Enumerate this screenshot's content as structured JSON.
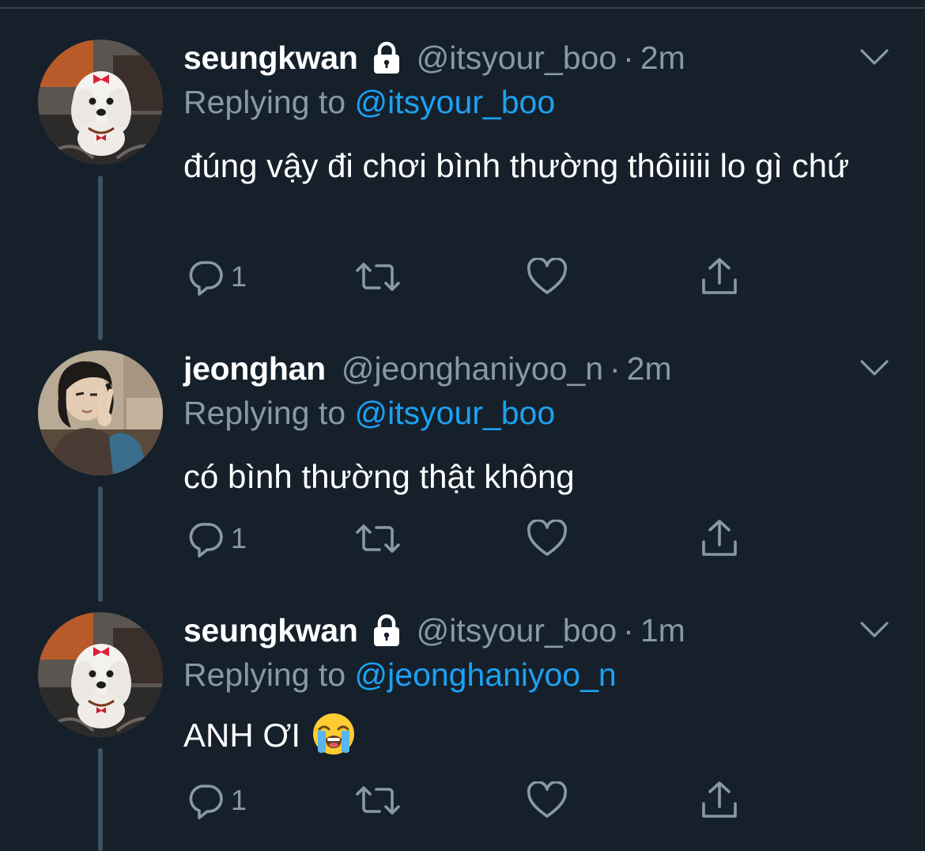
{
  "tweets": [
    {
      "name": "seungkwan",
      "protected": true,
      "handle": "@itsyour_boo",
      "dot": "·",
      "time": "2m",
      "replying_prefix": "Replying to",
      "replying_to": "@itsyour_boo",
      "text": "đúng vậy đi chơi bình thường thôiiiii lo gì chứ",
      "reply_count": "1",
      "avatar": "white-maltese-dog-with-red-bow"
    },
    {
      "name": "jeonghan",
      "protected": false,
      "handle": "@jeonghaniyoo_n",
      "dot": "·",
      "time": "2m",
      "replying_prefix": "Replying to",
      "replying_to": "@itsyour_boo",
      "text": "có bình thường thật không",
      "reply_count": "1",
      "avatar": "person-dark-hair-peace-sign"
    },
    {
      "name": "seungkwan",
      "protected": true,
      "handle": "@itsyour_boo",
      "dot": "·",
      "time": "1m",
      "replying_prefix": "Replying to",
      "replying_to": "@jeonghaniyoo_n",
      "text": "ANH ƠI",
      "emoji": "loudly-crying-face",
      "reply_count": "1",
      "avatar": "white-maltese-dog-with-red-bow"
    }
  ],
  "icons": {
    "reply": "reply-bubble-icon",
    "retweet": "retweet-icon",
    "like": "heart-icon",
    "share": "share-icon",
    "lock": "lock-icon",
    "menu": "chevron-down-icon"
  },
  "colors": {
    "background": "#15202b",
    "text": "#ffffff",
    "secondary": "#8899a6",
    "link": "#1da1f2",
    "thread_line": "#3d5466"
  }
}
